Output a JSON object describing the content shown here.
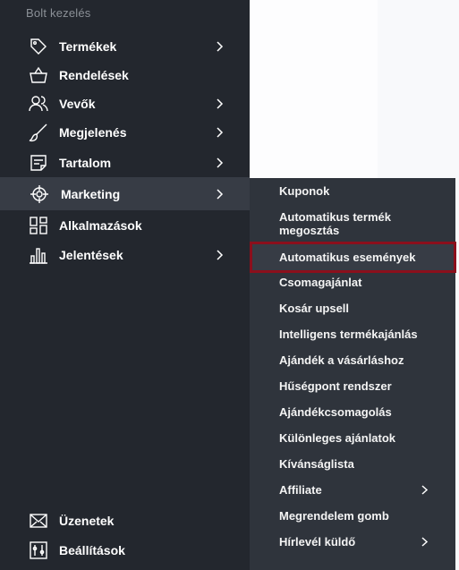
{
  "sidebar": {
    "section_title": "Bolt kezelés",
    "items": [
      {
        "label": "Termékek",
        "icon": "tag-icon",
        "has_submenu": true
      },
      {
        "label": "Rendelések",
        "icon": "basket-icon",
        "has_submenu": false
      },
      {
        "label": "Vevők",
        "icon": "users-icon",
        "has_submenu": true
      },
      {
        "label": "Megjelenés",
        "icon": "brush-icon",
        "has_submenu": true
      },
      {
        "label": "Tartalom",
        "icon": "content-icon",
        "has_submenu": true
      },
      {
        "label": "Marketing",
        "icon": "target-icon",
        "has_submenu": true,
        "active": true
      },
      {
        "label": "Alkalmazások",
        "icon": "apps-icon",
        "has_submenu": false
      },
      {
        "label": "Jelentések",
        "icon": "bar-chart-icon",
        "has_submenu": true
      }
    ],
    "bottom_items": [
      {
        "label": "Üzenetek",
        "icon": "mail-icon"
      },
      {
        "label": "Beállítások",
        "icon": "settings-icon"
      }
    ]
  },
  "submenu": {
    "items": [
      {
        "label": "Kuponok"
      },
      {
        "label": "Automatikus termék megosztás"
      },
      {
        "label": "Automatikus események",
        "highlighted": true
      },
      {
        "label": "Csomagajánlat"
      },
      {
        "label": "Kosár upsell"
      },
      {
        "label": "Intelligens termékajánlás"
      },
      {
        "label": "Ajándék a vásárláshoz"
      },
      {
        "label": "Hűségpont rendszer"
      },
      {
        "label": "Ajándékcsomagolás"
      },
      {
        "label": "Különleges ajánlatok"
      },
      {
        "label": "Kívánságlista"
      },
      {
        "label": "Affiliate",
        "has_submenu": true
      },
      {
        "label": "Megrendelem gomb"
      },
      {
        "label": "Hírlevél küldő",
        "has_submenu": true
      }
    ]
  },
  "colors": {
    "sidebar_bg": "#23272e",
    "submenu_bg": "#2f343c",
    "active_bg": "#373c45",
    "highlight_border": "#8b0f1c"
  }
}
